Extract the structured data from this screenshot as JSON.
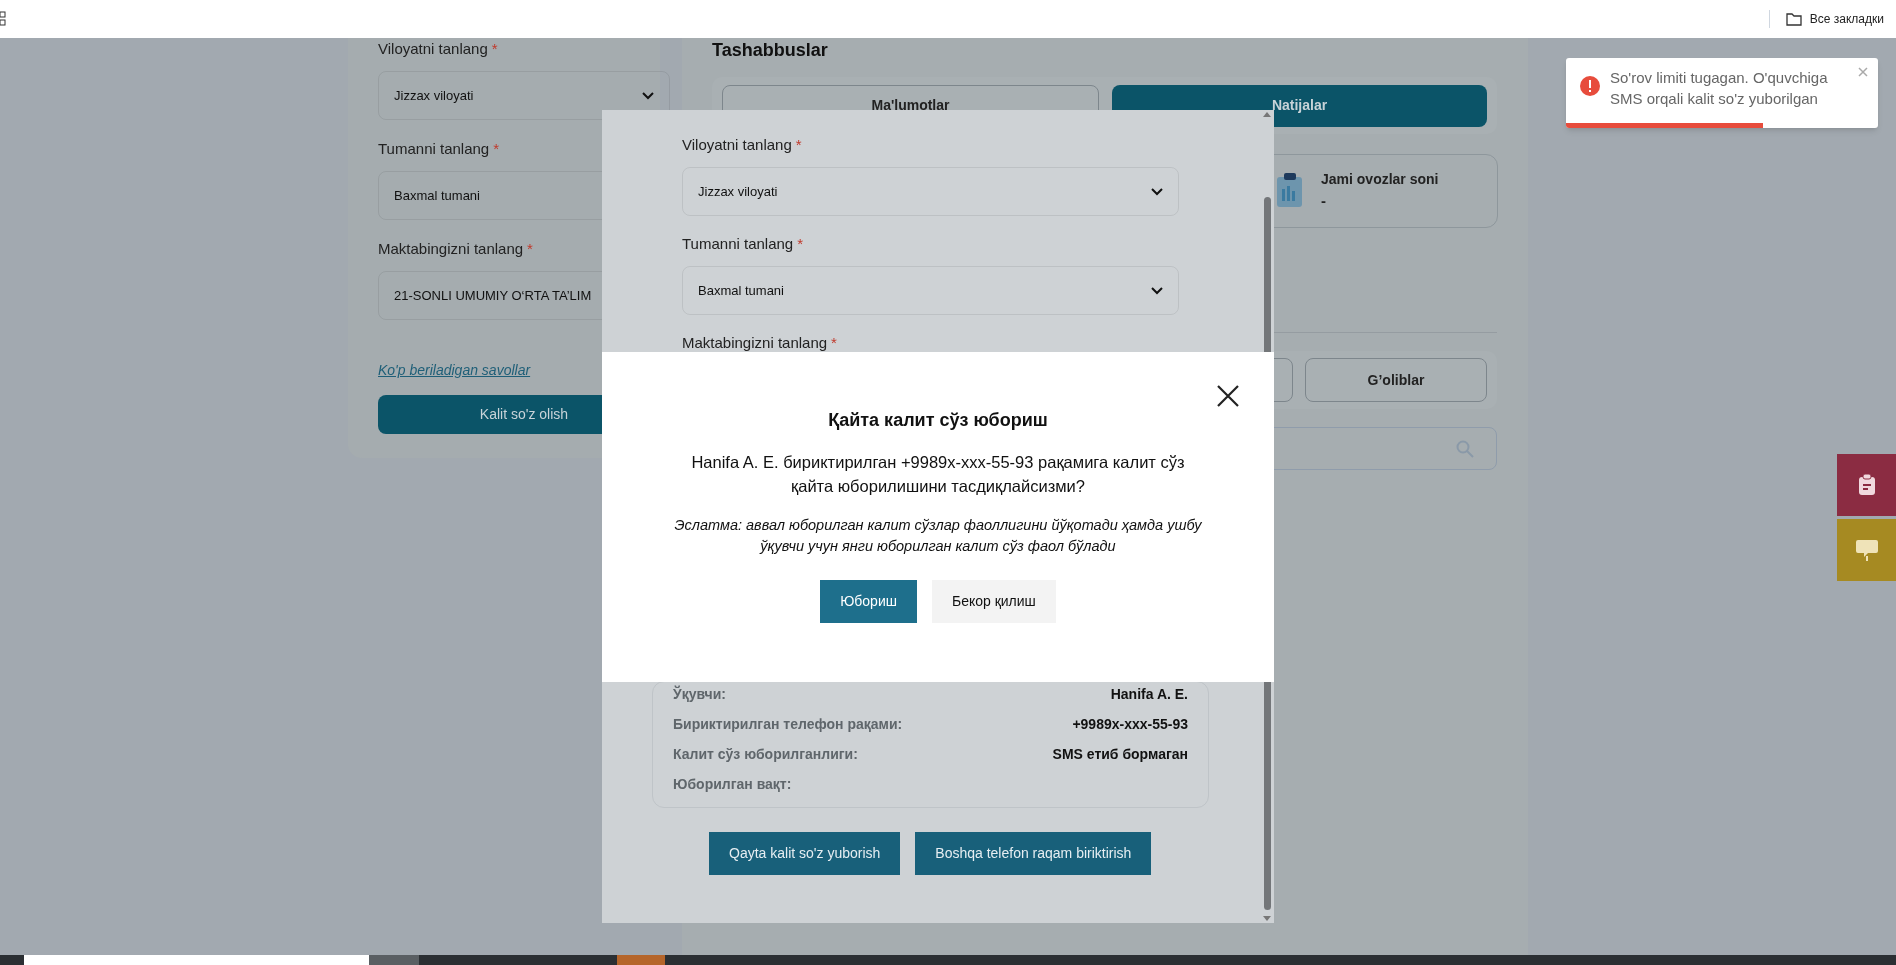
{
  "browser": {
    "bookmarks_label": "Все закладки"
  },
  "sidebar_form": {
    "fields": [
      {
        "label": "Viloyatni tanlang",
        "required": "*",
        "value": "Jizzax viloyati"
      },
      {
        "label": "Tumanni tanlang",
        "required": "*",
        "value": "Baxmal tumani"
      },
      {
        "label": "Maktabingizni tanlang",
        "required": "*",
        "value": "21-SONLI UMUMIY O‘RTA TA’LIM"
      }
    ],
    "faq_link": "Ko'p beriladigan savollar",
    "submit_button": "Kalit so'z olish"
  },
  "main": {
    "title": "Tashabbuslar",
    "tabs": [
      {
        "label": "Ma'lumotlar",
        "selected": false
      },
      {
        "label": "Natijalar",
        "selected": true
      }
    ],
    "stat": {
      "label": "Jami ovozlar soni",
      "value": "-"
    },
    "subtabs": [
      {
        "label": "G’oliblar",
        "selected": false
      }
    ]
  },
  "toast": {
    "kind": "error",
    "message": "So'rov limiti tugagan. O'quvchiga SMS orqali kalit so'z yuborilgan",
    "level": 0.63
  },
  "side_buttons": [
    {
      "kind": "clipboard",
      "color": "#8b2c42"
    },
    {
      "kind": "chat",
      "color": "#a68a22"
    }
  ],
  "modal": {
    "fields": [
      {
        "label": "Viloyatni tanlang",
        "required": "*",
        "value": "Jizzax viloyati"
      },
      {
        "label": "Tumanni tanlang",
        "required": "*",
        "value": "Baxmal tumani"
      },
      {
        "label": "Maktabingizni tanlang",
        "required": "*"
      }
    ],
    "info": [
      {
        "label": "Ўқувчи:",
        "value": "Hanifa A. E."
      },
      {
        "label": "Бириктирилган телефон рақами:",
        "value": "+9989x-xxx-55-93"
      },
      {
        "label": "Калит сўз юборилганлиги:",
        "value": "SMS етиб бормаган"
      },
      {
        "label": "Юборилган вақт:"
      }
    ],
    "buttons": [
      "Qayta kalit so'z yuborish",
      "Boshqa telefon raqam biriktirish"
    ]
  },
  "confirm": {
    "title": "Қайта калит сўз юбориш",
    "message": "Hanifa A. E. бириктирилган +9989x-xxx-55-93 рақамига калит сўз қайта юборилишини тасдиқлайсизми?",
    "note": "Эслатма: аввал юборилган калит сўзлар фаоллигини йўқотади ҳамда ушбу ўқувчи учун янги юборилган калит сўз фаол бўлади",
    "buttons": [
      {
        "label": "Юбориш",
        "kind": "primary"
      },
      {
        "label": "Бекор қилиш",
        "kind": "secondary"
      }
    ]
  }
}
